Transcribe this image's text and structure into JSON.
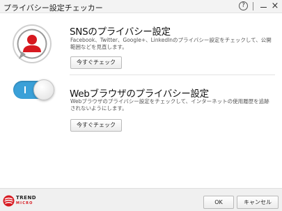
{
  "window": {
    "title": "プライバシー設定チェッカー",
    "help_label": "?",
    "minimize_label": "",
    "close_label": "×"
  },
  "sections": [
    {
      "title": "SNSのプライバシー設定",
      "description": "Facebook、Twitter、Google+、LinkedInのプライバシー設定をチェックして、公開範囲などを見直します。",
      "button_label": "今すぐチェック",
      "icon": "person-icon"
    },
    {
      "title": "Webブラウザのプライバシー設定",
      "description": "Webブラウザのプライバシー設定をチェックして、インターネットの使用履歴を追跡されないようにします。",
      "button_label": "今すぐチェック",
      "icon": "toggle-switch-icon",
      "toggle_state": "on"
    }
  ],
  "footer": {
    "brand_name": "TREND",
    "brand_sub": "MICRO",
    "ok_label": "OK",
    "cancel_label": "キャンセル"
  },
  "colors": {
    "accent_red": "#d71920",
    "toggle_blue": "#3aa0d8"
  }
}
